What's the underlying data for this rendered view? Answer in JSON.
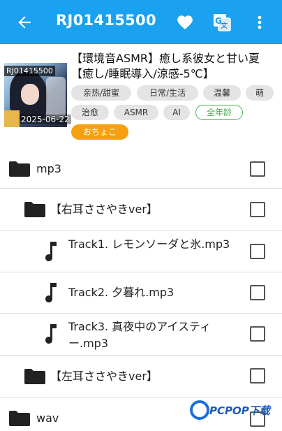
{
  "appbar": {
    "title": "RJ01415500",
    "icons": [
      "back-arrow-icon",
      "heart-icon",
      "translate-icon",
      "more-vert-icon"
    ]
  },
  "work": {
    "id_overlay": "RJ01415500",
    "date": "2025-06-22",
    "title": "【環境音ASMR】癒し系彼女と甘い夏【癒し/睡眠導入/涼感-5℃】",
    "tags": [
      "亲热/甜蜜",
      "日常/生活",
      "温馨",
      "萌",
      "治愈",
      "ASMR",
      "AI"
    ],
    "age_rating": "全年龄",
    "circle": "おちょこ"
  },
  "files": [
    {
      "type": "folder",
      "name": "mp3"
    },
    {
      "type": "folder",
      "name": "【右耳ささやきver】"
    },
    {
      "type": "audio",
      "name": "Track1. レモンソーダと氷.mp3"
    },
    {
      "type": "audio",
      "name": "Track2. 夕暮れ.mp3"
    },
    {
      "type": "audio",
      "name": "Track3. 真夜中のアイスティー.mp3"
    },
    {
      "type": "folder",
      "name": "【左耳ささやきver】"
    },
    {
      "type": "folder",
      "name": "wav"
    }
  ],
  "watermark": {
    "text": "PCPOP下载"
  },
  "colors": {
    "appbar": "#1aa1ef",
    "circle_tag": "#f5a10f",
    "age_tag": "#4caf50"
  }
}
